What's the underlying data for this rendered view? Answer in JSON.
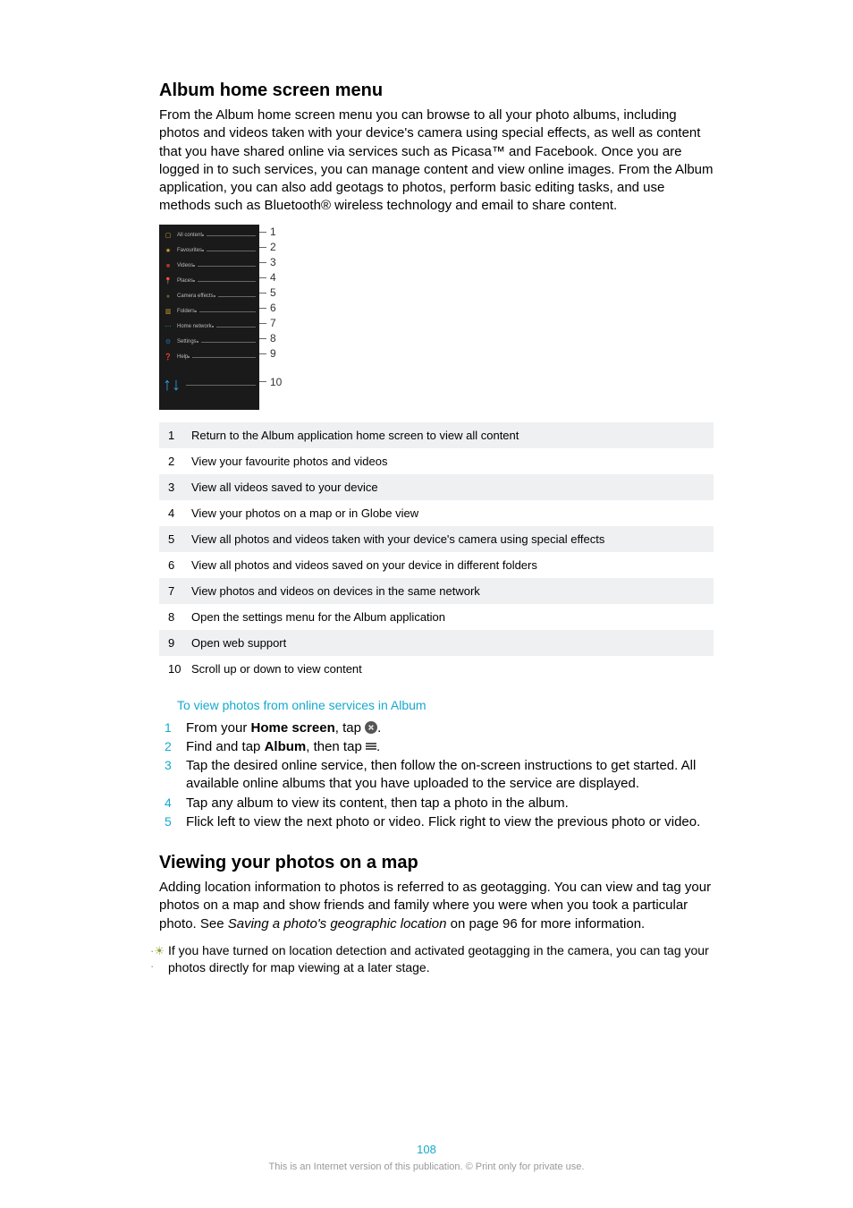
{
  "section1": {
    "title": "Album home screen menu",
    "para": "From the Album home screen menu you can browse to all your photo albums, including photos and videos taken with your device's camera using special effects, as well as content that you have shared online via services such as Picasa™ and Facebook. Once you are logged in to such services, you can manage content and view online images. From the Album application, you can also add geotags to photos, perform basic editing tasks, and use methods such as Bluetooth® wireless technology and email to share content."
  },
  "phone_menu": [
    {
      "icon": "▢",
      "color": "#d9a441",
      "label": "All content"
    },
    {
      "icon": "★",
      "color": "#d9a441",
      "label": "Favourites"
    },
    {
      "icon": "■",
      "color": "#b43a2e",
      "label": "Videos"
    },
    {
      "icon": "📍",
      "color": "#1f6fb0",
      "label": "Places"
    },
    {
      "icon": "●",
      "color": "#6b5b3e",
      "label": "Camera effects"
    },
    {
      "icon": "▥",
      "color": "#c8a12b",
      "label": "Folders"
    },
    {
      "icon": "⋯",
      "color": "#2aa198",
      "label": "Home network"
    },
    {
      "icon": "⚙",
      "color": "#1f6fb0",
      "label": "Settings"
    },
    {
      "icon": "❓",
      "color": "#5a8a3a",
      "label": "Help"
    }
  ],
  "callouts": [
    "1",
    "2",
    "3",
    "4",
    "5",
    "6",
    "7",
    "8",
    "9",
    "10"
  ],
  "legend": [
    {
      "n": "1",
      "t": "Return to the Album application home screen to view all content"
    },
    {
      "n": "2",
      "t": "View your favourite photos and videos"
    },
    {
      "n": "3",
      "t": "View all videos saved to your device"
    },
    {
      "n": "4",
      "t": "View your photos on a map or in Globe view"
    },
    {
      "n": "5",
      "t": "View all photos and videos taken with your device's camera using special effects"
    },
    {
      "n": "6",
      "t": "View all photos and videos saved on your device in different folders"
    },
    {
      "n": "7",
      "t": "View photos and videos on devices in the same network"
    },
    {
      "n": "8",
      "t": "Open the settings menu for the Album application"
    },
    {
      "n": "9",
      "t": "Open web support"
    },
    {
      "n": "10",
      "t": "Scroll up or down to view content"
    }
  ],
  "subhead": "To view photos from online services in Album",
  "steps": {
    "s1a": "From your ",
    "s1b": "Home screen",
    "s1c": ", tap ",
    "s2a": "Find and tap ",
    "s2b": "Album",
    "s2c": ", then tap ",
    "s3": "Tap the desired online service, then follow the on-screen instructions to get started. All available online albums that you have uploaded to the service are displayed.",
    "s4": "Tap any album to view its content, then tap a photo in the album.",
    "s5": "Flick left to view the next photo or video. Flick right to view the previous photo or video."
  },
  "section2": {
    "title": "Viewing your photos on a map",
    "para_a": "Adding location information to photos is referred to as geotagging. You can view and tag your photos on a map and show friends and family where you were when you took a particular photo. See ",
    "para_ref": "Saving a photo's geographic location",
    "para_b": " on page 96 for more information."
  },
  "tip": "If you have turned on location detection and activated geotagging in the camera, you can tag your photos directly for map viewing at a later stage.",
  "footer": {
    "page": "108",
    "note": "This is an Internet version of this publication. © Print only for private use."
  }
}
